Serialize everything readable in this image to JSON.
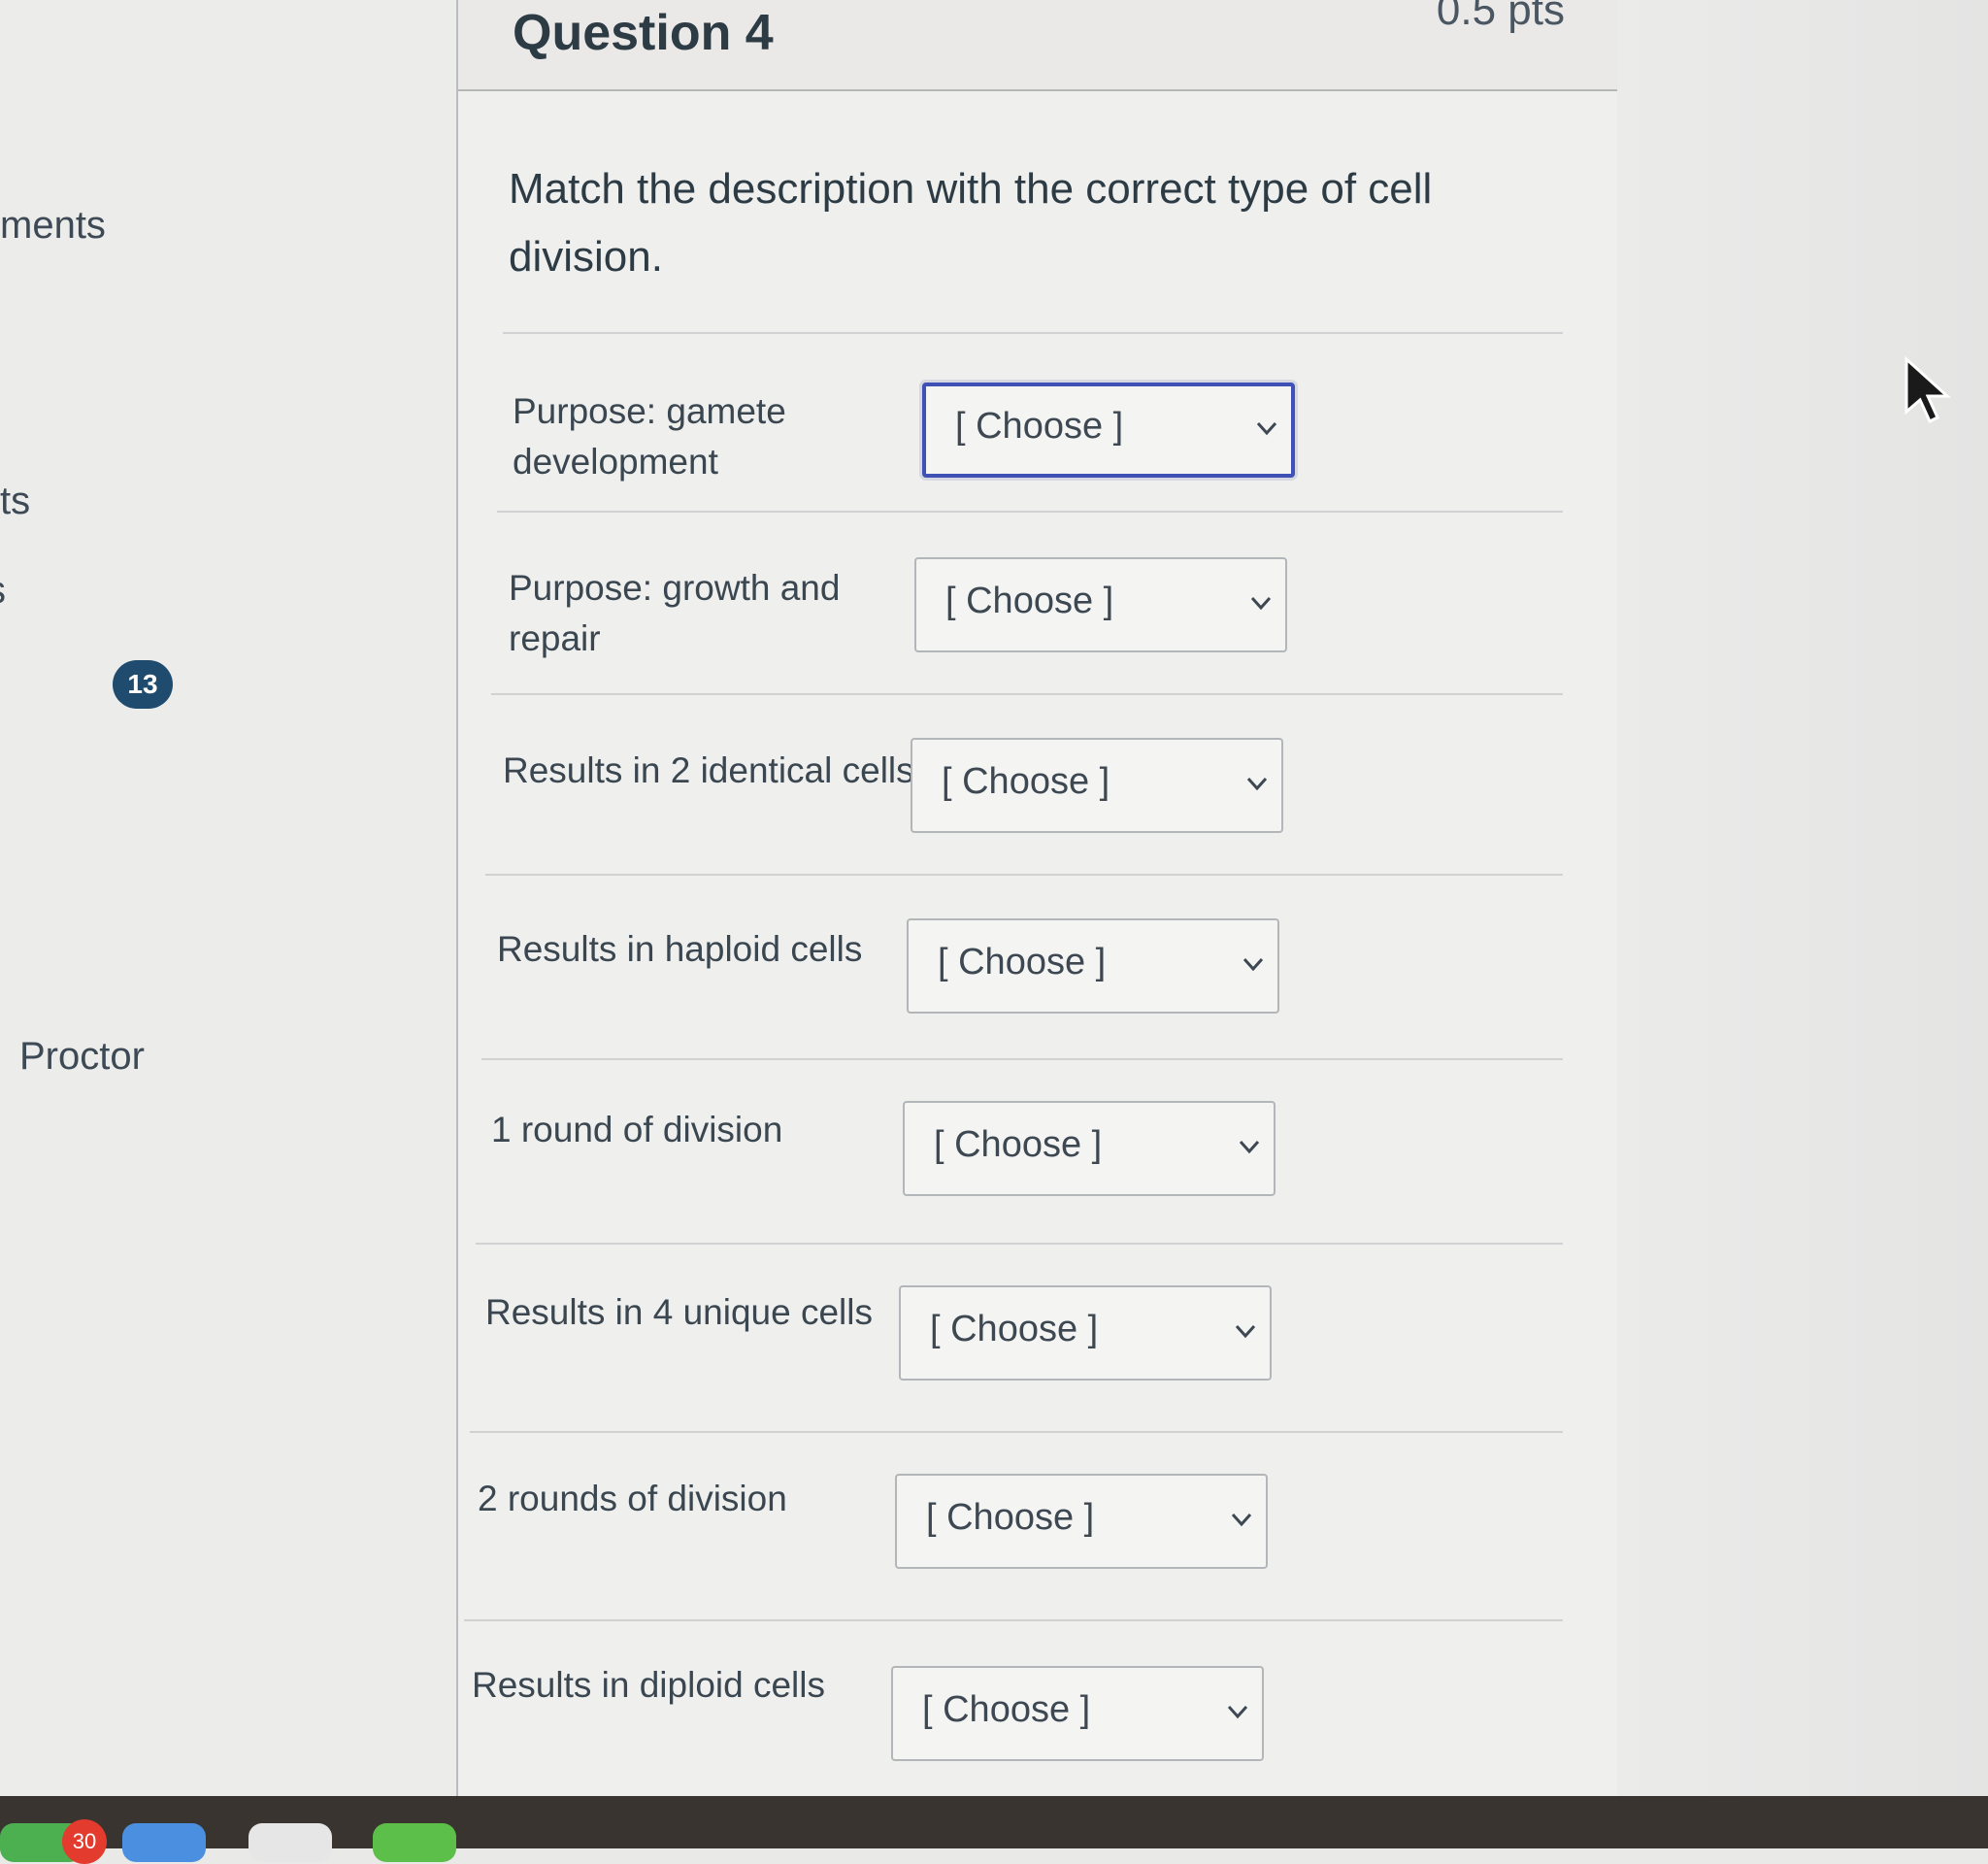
{
  "left_nav": {
    "items": [
      {
        "label": "ments"
      },
      {
        "label": "ts"
      },
      {
        "label": "s"
      },
      {
        "label": "Proctor"
      }
    ],
    "badge": "13"
  },
  "question": {
    "title": "Question 4",
    "points": "0.5 pts",
    "prompt": "Match the description with the correct type of cell division.",
    "rows": [
      {
        "label": "Purpose: gamete development",
        "selected": "[ Choose ]"
      },
      {
        "label": "Purpose: growth and repair",
        "selected": "[ Choose ]"
      },
      {
        "label": "Results in 2 identical cells",
        "selected": "[ Choose ]"
      },
      {
        "label": "Results in haploid cells",
        "selected": "[ Choose ]"
      },
      {
        "label": "1 round of division",
        "selected": "[ Choose ]"
      },
      {
        "label": "Results in 4 unique cells",
        "selected": "[ Choose ]"
      },
      {
        "label": "2 rounds of division",
        "selected": "[ Choose ]"
      },
      {
        "label": "Results in diploid cells",
        "selected": "[ Choose ]"
      }
    ]
  },
  "dock": {
    "badge": "30"
  },
  "colors": {
    "focus_border": "#3f51b5",
    "badge_bg": "#1e4b6e",
    "text": "#2d3b45"
  }
}
